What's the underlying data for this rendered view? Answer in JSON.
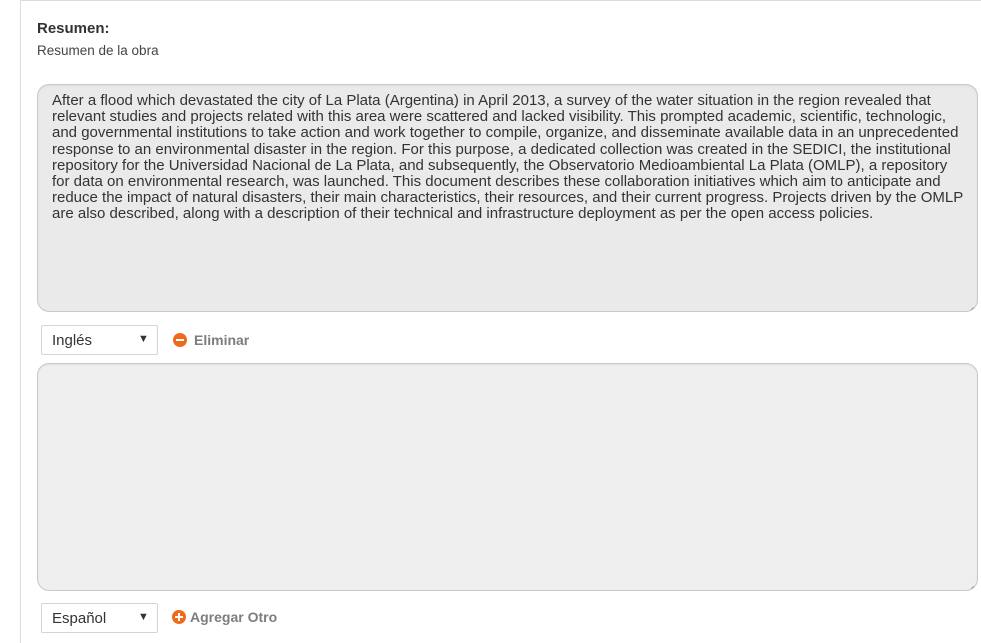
{
  "section": {
    "title": "Resumen:",
    "hint": "Resumen de la obra"
  },
  "entries": [
    {
      "text": "After a flood which devastated the city of La Plata (Argentina) in April 2013, a survey of the water situation in the region revealed that relevant studies and projects related with this area were scattered and lacked visibility. This prompted academic, scientific, technologic, and governmental institutions to take action and work together to compile, organize, and disseminate available data in an unprecedented response to an environmental disaster in the region. For this purpose, a dedicated collection was created in the SEDICI, the institutional repository for the Universidad Nacional de La Plata, and subsequently, the Observatorio Medioambiental La Plata (OMLP), a repository for data on environmental research, was launched. This document describes these collaboration initiatives which aim to anticipate and reduce the impact of natural disasters, their main characteristics, their resources, and their current progress. Projects driven by the OMLP are also described, along with a description of their technical and infrastructure deployment as per the open access policies.",
      "language": "Inglés",
      "action_label": "Eliminar"
    },
    {
      "text": "",
      "language": "Español",
      "action_label": "Agregar Otro"
    }
  ],
  "colors": {
    "accent": "#ef6a1a",
    "textarea_bg": "#ececec"
  },
  "icons": {
    "remove": "minus-circle-icon",
    "add": "plus-circle-icon",
    "dropdown": "triangle-down-icon"
  }
}
